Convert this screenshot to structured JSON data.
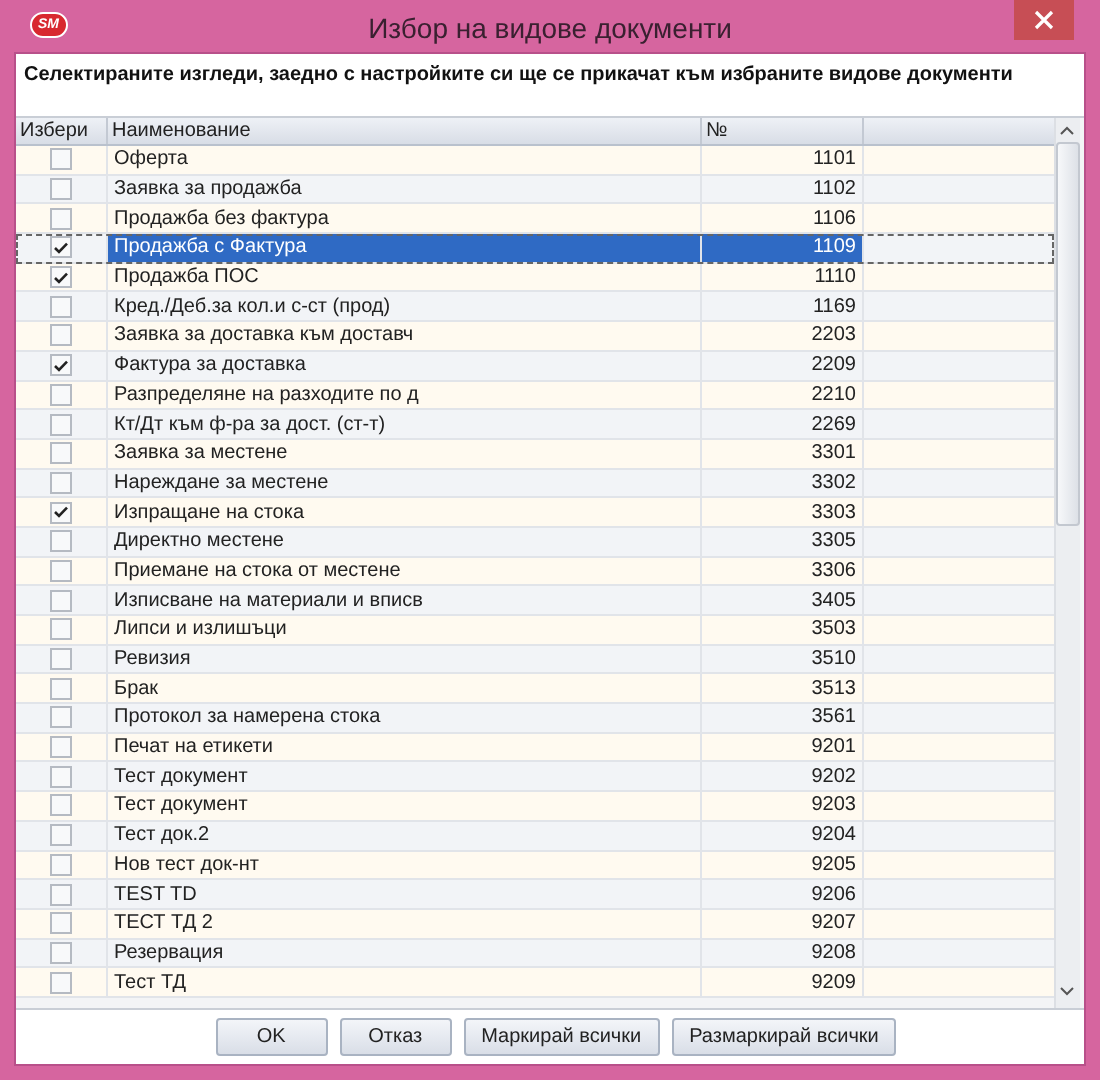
{
  "window": {
    "title": "Избор на видове документи",
    "logo": "SM"
  },
  "instruction": "Селектираните изгледи, заедно с настройките си ще се прикачат към избраните видове документи",
  "table": {
    "columns": [
      "Избери",
      "Наименование",
      "№"
    ],
    "rows": [
      {
        "checked": false,
        "name": "Оферта",
        "number": "1101",
        "selected": false
      },
      {
        "checked": false,
        "name": "Заявка за продажба",
        "number": "1102",
        "selected": false
      },
      {
        "checked": false,
        "name": "Продажба без фактура",
        "number": "1106",
        "selected": false
      },
      {
        "checked": true,
        "name": "Продажба с Фактура",
        "number": "1109",
        "selected": true
      },
      {
        "checked": true,
        "name": "Продажба ПОС",
        "number": "1110",
        "selected": false
      },
      {
        "checked": false,
        "name": "Кред./Деб.за кол.и с-ст (прод)",
        "number": "1169",
        "selected": false
      },
      {
        "checked": false,
        "name": "Заявка за доставка към доставч",
        "number": "2203",
        "selected": false
      },
      {
        "checked": true,
        "name": "Фактура за доставка",
        "number": "2209",
        "selected": false
      },
      {
        "checked": false,
        "name": "Разпределяне на разходите по д",
        "number": "2210",
        "selected": false
      },
      {
        "checked": false,
        "name": "Кт/Дт към ф-ра за дост. (ст-т)",
        "number": "2269",
        "selected": false
      },
      {
        "checked": false,
        "name": "Заявка за местене",
        "number": "3301",
        "selected": false
      },
      {
        "checked": false,
        "name": "Нареждане за местене",
        "number": "3302",
        "selected": false
      },
      {
        "checked": true,
        "name": "Изпращане на стока",
        "number": "3303",
        "selected": false
      },
      {
        "checked": false,
        "name": "Директно местене",
        "number": "3305",
        "selected": false
      },
      {
        "checked": false,
        "name": "Приемане на стока от местене",
        "number": "3306",
        "selected": false
      },
      {
        "checked": false,
        "name": "Изписване на материали и впиcв",
        "number": "3405",
        "selected": false
      },
      {
        "checked": false,
        "name": "Липси и излишъци",
        "number": "3503",
        "selected": false
      },
      {
        "checked": false,
        "name": "Ревизия",
        "number": "3510",
        "selected": false
      },
      {
        "checked": false,
        "name": "Брак",
        "number": "3513",
        "selected": false
      },
      {
        "checked": false,
        "name": "Протокол за намерена стока",
        "number": "3561",
        "selected": false
      },
      {
        "checked": false,
        "name": "Печат на етикети",
        "number": "9201",
        "selected": false
      },
      {
        "checked": false,
        "name": "Тест документ",
        "number": "9202",
        "selected": false
      },
      {
        "checked": false,
        "name": "Тест документ",
        "number": "9203",
        "selected": false
      },
      {
        "checked": false,
        "name": "Тест док.2",
        "number": "9204",
        "selected": false
      },
      {
        "checked": false,
        "name": "Нов тест док-нт",
        "number": "9205",
        "selected": false
      },
      {
        "checked": false,
        "name": "TEST TD",
        "number": "9206",
        "selected": false
      },
      {
        "checked": false,
        "name": "ТЕСТ ТД 2",
        "number": "9207",
        "selected": false
      },
      {
        "checked": false,
        "name": "Резервация",
        "number": "9208",
        "selected": false
      },
      {
        "checked": false,
        "name": "Тест ТД",
        "number": "9209",
        "selected": false
      }
    ]
  },
  "buttons": [
    "OK",
    "Отказ",
    "Маркирай всички",
    "Размаркирай всички"
  ]
}
